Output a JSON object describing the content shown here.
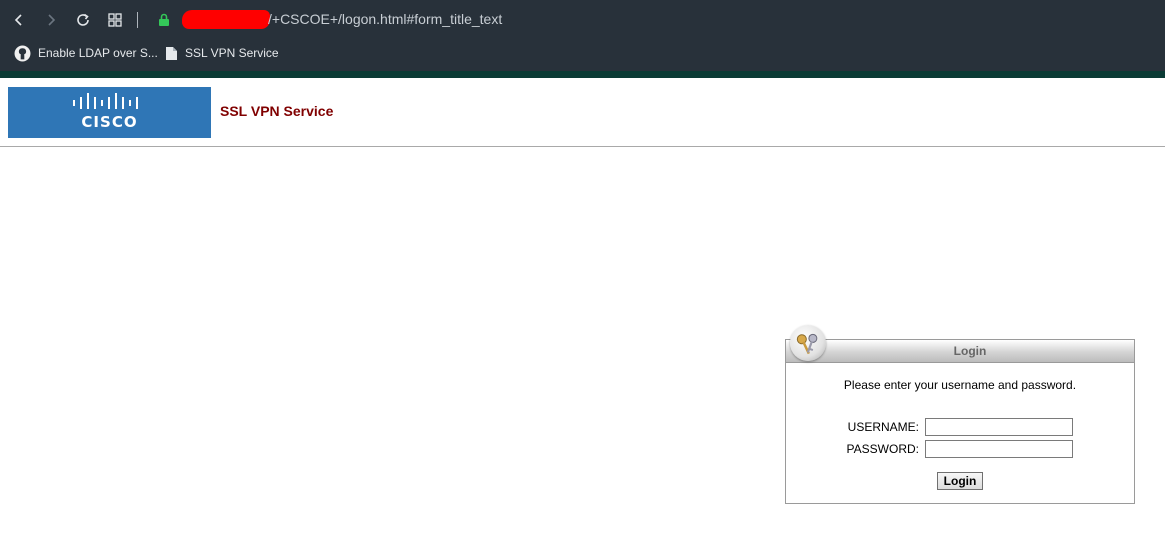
{
  "browser": {
    "url_visible": "/+CSCOE+/logon.html#form_title_text",
    "bookmarks": [
      {
        "label": "Enable LDAP over S...",
        "icon": "github-icon"
      },
      {
        "label": "SSL VPN Service",
        "icon": "page-icon"
      }
    ]
  },
  "header": {
    "logo_text": "CISCO",
    "title": "SSL VPN Service",
    "title_color": "#800000",
    "logo_color": "#2f76b6"
  },
  "login": {
    "panel_title": "Login",
    "prompt": "Please enter your username and password.",
    "username_label": "USERNAME:",
    "password_label": "PASSWORD:",
    "username_value": "",
    "password_value": "",
    "button_label": "Login"
  }
}
